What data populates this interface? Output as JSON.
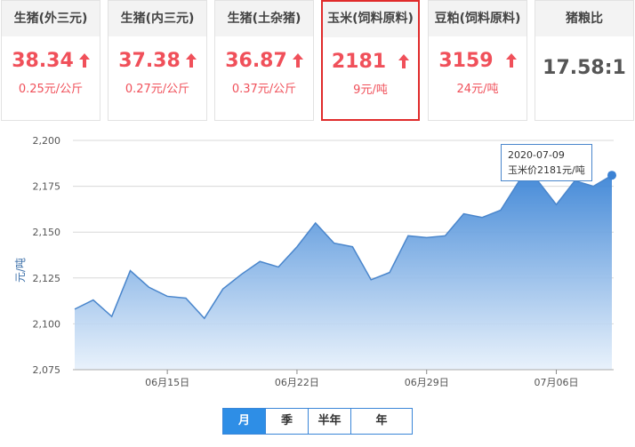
{
  "cards": [
    {
      "title": "生猪(外三元)",
      "price": "38.34",
      "change": "0.25元/公斤",
      "arrow": "up"
    },
    {
      "title": "生猪(内三元)",
      "price": "37.38",
      "change": "0.27元/公斤",
      "arrow": "up"
    },
    {
      "title": "生猪(土杂猪)",
      "price": "36.87",
      "change": "0.37元/公斤",
      "arrow": "up"
    },
    {
      "title": "玉米(饲料原料)",
      "price": "2181",
      "change": "9元/吨",
      "arrow": "up"
    },
    {
      "title": "豆粕(饲料原料)",
      "price": "3159",
      "change": "24元/吨",
      "arrow": "up"
    },
    {
      "title": "猪粮比",
      "price": "17.58:1"
    }
  ],
  "selected_card": 3,
  "colors": {
    "up": "#f0505a",
    "line": "#4a86cc",
    "accent": "#2e8ee6",
    "selected_border": "#e02b2b"
  },
  "tooltip": {
    "date": "2020-07-09",
    "text": "玉米价2181元/吨"
  },
  "range_tabs": [
    "月",
    "季",
    "半年",
    "年"
  ],
  "selected_range": 0,
  "chart_data": {
    "type": "area",
    "title": "",
    "xlabel": "",
    "ylabel": "元/吨",
    "ylim": [
      2075,
      2200
    ],
    "yticks": [
      2075,
      2100,
      2125,
      2150,
      2175,
      2200
    ],
    "ytick_labels": [
      "2,075",
      "2,100",
      "2,125",
      "2,150",
      "2,175",
      "2,200"
    ],
    "xtick_labels": [
      "06月15日",
      "06月22日",
      "06月29日",
      "07月06日"
    ],
    "xtick_dates": [
      "2020-06-15",
      "2020-06-22",
      "2020-06-29",
      "2020-07-06"
    ],
    "grid": true,
    "x": [
      "2020-06-10",
      "2020-06-11",
      "2020-06-12",
      "2020-06-13",
      "2020-06-14",
      "2020-06-15",
      "2020-06-16",
      "2020-06-17",
      "2020-06-18",
      "2020-06-19",
      "2020-06-20",
      "2020-06-21",
      "2020-06-22",
      "2020-06-23",
      "2020-06-24",
      "2020-06-25",
      "2020-06-26",
      "2020-06-27",
      "2020-06-28",
      "2020-06-29",
      "2020-06-30",
      "2020-07-01",
      "2020-07-02",
      "2020-07-03",
      "2020-07-04",
      "2020-07-05",
      "2020-07-06",
      "2020-07-07",
      "2020-07-08",
      "2020-07-09"
    ],
    "series": [
      {
        "values": [
          2108,
          2113,
          2104,
          2129,
          2120,
          2115,
          2114,
          2103,
          2119,
          2127,
          2134,
          2131,
          2142,
          2155,
          2144,
          2142,
          2124,
          2128,
          2148,
          2147,
          2148,
          2160,
          2158,
          2162,
          2178,
          2178,
          2165,
          2178,
          2175,
          2181
        ]
      }
    ]
  }
}
